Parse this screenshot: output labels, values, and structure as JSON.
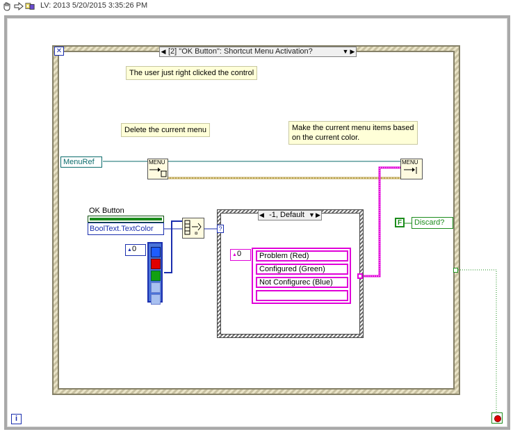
{
  "toolbar": {
    "title": "LV: 2013 5/20/2015 3:35:26 PM",
    "icons": [
      "hand-icon",
      "arrow-right-icon",
      "highlight-icon",
      "retain-icon"
    ]
  },
  "event_structure": {
    "selector_label": "[2] \"OK Button\": Shortcut Menu Activation?",
    "left_arrow": "◀",
    "right_arrow": "▶",
    "down_arrow": "▼"
  },
  "comments": {
    "right_clicked": "The user just right clicked the control",
    "delete_menu": "Delete the current menu",
    "make_items": "Make the current menu items based on the current color."
  },
  "terminals": {
    "menuref": "MenuRef",
    "ok_button": "OK Button",
    "bool_prop": "BoolText.TextColor",
    "discard": "Discard?",
    "discard_const": "F",
    "question": "?"
  },
  "nodes": {
    "menu_tag": "MENU"
  },
  "case_structure": {
    "selector_label": "-1, Default",
    "left_arrow": "◀",
    "right_arrow": "▶",
    "down_arrow": "▼"
  },
  "ring_array": {
    "index": "0",
    "items": [
      "Problem (Red)",
      "Configured (Green)",
      "Not Configurec (Blue)",
      ""
    ]
  },
  "color_array": {
    "index": "0",
    "colors": [
      "#1e5cff",
      "#e00000",
      "#12a012",
      "#a8c0f0"
    ]
  },
  "bottom": {
    "info": "i"
  },
  "colors": {
    "refnum_wire": "#0a6b6b",
    "menu_wire": "#c8b060",
    "color_wire": "#1a2eae",
    "string_wire": "#e000d8",
    "bool_wire": "#1b8c1b"
  }
}
